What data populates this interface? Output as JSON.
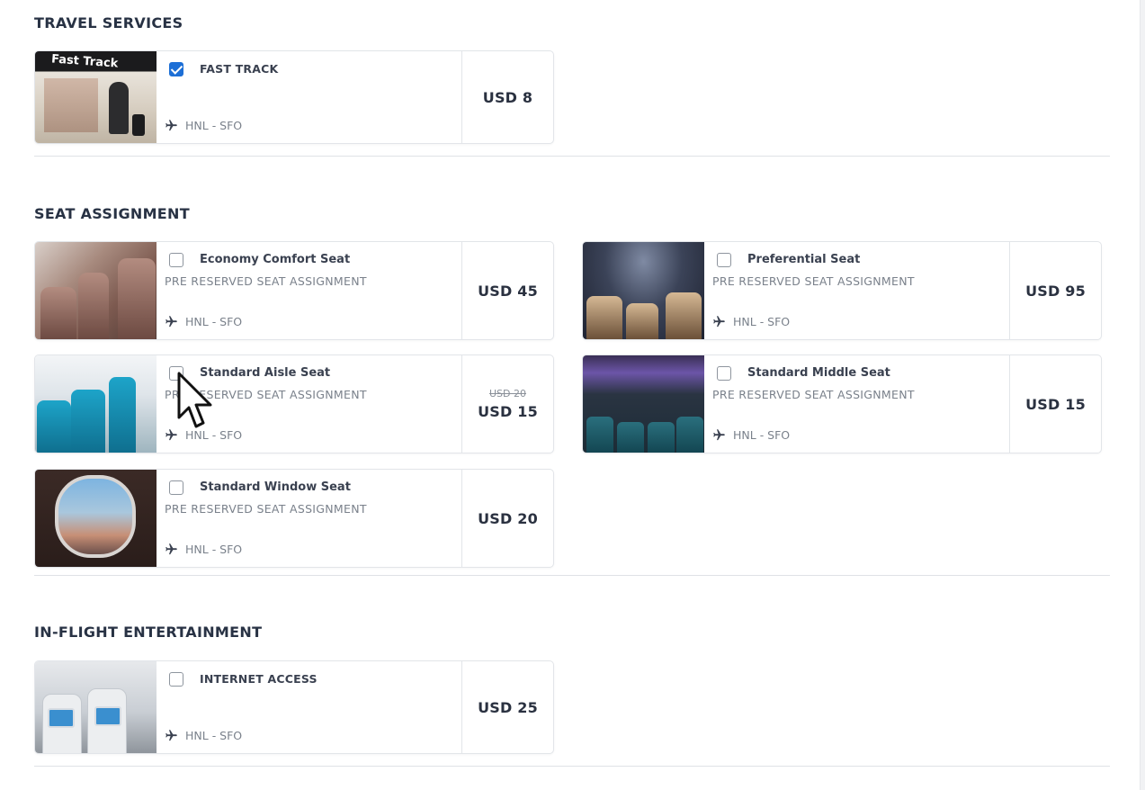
{
  "sections": {
    "travel_services": {
      "title": "TRAVEL SERVICES",
      "items": [
        {
          "name": "FAST TRACK",
          "subtitle": "",
          "route": "HNL - SFO",
          "price": "USD 8",
          "old_price": "",
          "checked": true,
          "image": "fast-track-photo"
        }
      ]
    },
    "seat_assignment": {
      "title": "SEAT ASSIGNMENT",
      "items": [
        {
          "name": "Economy Comfort Seat",
          "subtitle": "PRE RESERVED SEAT ASSIGNMENT",
          "route": "HNL - SFO",
          "price": "USD 45",
          "old_price": "",
          "checked": false,
          "image": "economy-comfort-seat-photo"
        },
        {
          "name": "Preferential Seat",
          "subtitle": "PRE RESERVED SEAT ASSIGNMENT",
          "route": "HNL - SFO",
          "price": "USD 95",
          "old_price": "",
          "checked": false,
          "image": "preferential-seat-photo"
        },
        {
          "name": "Standard Aisle Seat",
          "subtitle": "PRE RESERVED SEAT ASSIGNMENT",
          "route": "HNL - SFO",
          "price": "USD 15",
          "old_price": "USD 20",
          "checked": false,
          "image": "standard-aisle-seat-photo"
        },
        {
          "name": "Standard Middle Seat",
          "subtitle": "PRE RESERVED SEAT ASSIGNMENT",
          "route": "HNL - SFO",
          "price": "USD 15",
          "old_price": "",
          "checked": false,
          "image": "standard-middle-seat-photo"
        },
        {
          "name": "Standard Window Seat",
          "subtitle": "PRE RESERVED SEAT ASSIGNMENT",
          "route": "HNL - SFO",
          "price": "USD 20",
          "old_price": "",
          "checked": false,
          "image": "standard-window-seat-photo"
        }
      ]
    },
    "inflight_entertainment": {
      "title": "IN-FLIGHT ENTERTAINMENT",
      "items": [
        {
          "name": "INTERNET ACCESS",
          "subtitle": "",
          "route": "HNL - SFO",
          "price": "USD 25",
          "old_price": "",
          "checked": false,
          "image": "internet-access-photo"
        }
      ]
    }
  },
  "fast_track_image_text": "Fast Track",
  "icons": {
    "route": "airplane-icon",
    "pointer": "mouse-cursor-icon"
  },
  "colors": {
    "checkbox_checked": "#1d6fd6",
    "text": "#2a3140",
    "muted": "#7a818b",
    "border": "#e2e5e9"
  }
}
